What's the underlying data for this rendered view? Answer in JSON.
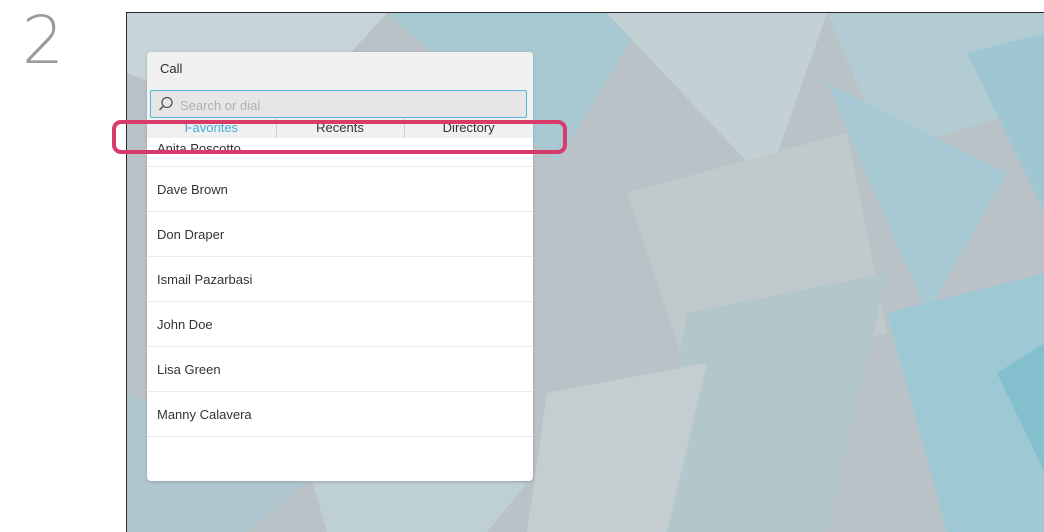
{
  "step": {
    "number": "2"
  },
  "panel": {
    "title": "Call",
    "search": {
      "placeholder": "Search or dial",
      "value": ""
    },
    "tabs": [
      {
        "label": "Favorites",
        "active": true
      },
      {
        "label": "Recents",
        "active": false
      },
      {
        "label": "Directory",
        "active": false
      }
    ],
    "contacts": [
      "Anita Poscotto",
      "Dave Brown",
      "Don Draper",
      "Ismail Pazarbasi",
      "John Doe",
      "Lisa Green",
      "Manny Calavera"
    ]
  },
  "colors": {
    "accent": "#3dafd8",
    "highlight": "#d83a6a",
    "background": "#b8c2c6"
  },
  "icons": {
    "search": "search-icon"
  }
}
